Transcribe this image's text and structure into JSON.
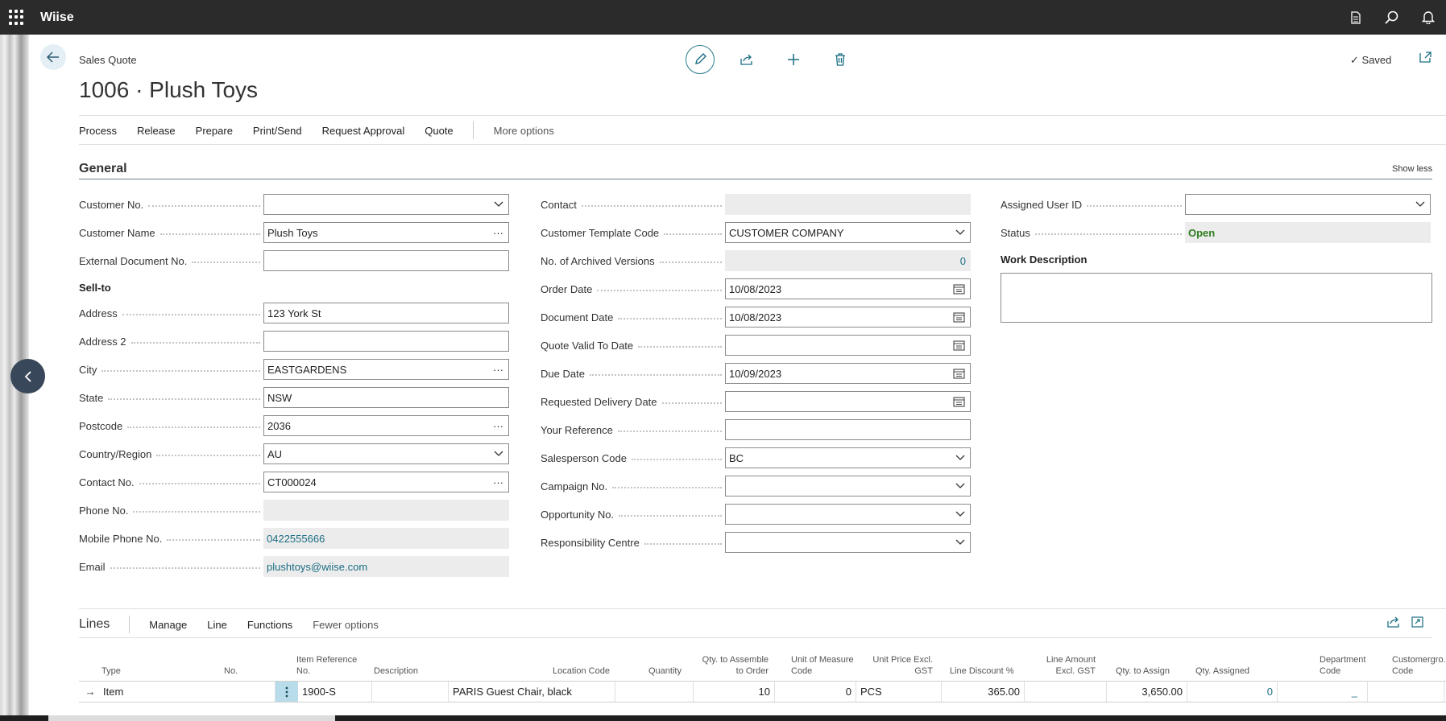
{
  "app": {
    "name": "Wiise"
  },
  "page": {
    "caption": "Sales Quote",
    "title": "1006 · Plush Toys",
    "saved_label": "Saved"
  },
  "menu": {
    "items": [
      "Process",
      "Release",
      "Prepare",
      "Print/Send",
      "Request Approval",
      "Quote"
    ],
    "more": "More options"
  },
  "general": {
    "title": "General",
    "show_less": "Show less",
    "sell_to_label": "Sell-to",
    "work_description_label": "Work Description",
    "col1": [
      {
        "label": "Customer No.",
        "value": ""
      },
      {
        "label": "Customer Name",
        "value": "Plush Toys"
      },
      {
        "label": "External Document No.",
        "value": ""
      },
      {
        "label": "Address",
        "value": "123 York St"
      },
      {
        "label": "Address 2",
        "value": ""
      },
      {
        "label": "City",
        "value": "EASTGARDENS"
      },
      {
        "label": "State",
        "value": "NSW"
      },
      {
        "label": "Postcode",
        "value": "2036"
      },
      {
        "label": "Country/Region",
        "value": "AU"
      },
      {
        "label": "Contact No.",
        "value": "CT000024"
      },
      {
        "label": "Phone No.",
        "value": ""
      },
      {
        "label": "Mobile Phone No.",
        "value": "0422555666"
      },
      {
        "label": "Email",
        "value": "plushtoys@wiise.com"
      }
    ],
    "col2": [
      {
        "label": "Contact",
        "value": ""
      },
      {
        "label": "Customer Template Code",
        "value": "CUSTOMER COMPANY"
      },
      {
        "label": "No. of Archived Versions",
        "value": "0"
      },
      {
        "label": "Order Date",
        "value": "10/08/2023"
      },
      {
        "label": "Document Date",
        "value": "10/08/2023"
      },
      {
        "label": "Quote Valid To Date",
        "value": ""
      },
      {
        "label": "Due Date",
        "value": "10/09/2023"
      },
      {
        "label": "Requested Delivery Date",
        "value": ""
      },
      {
        "label": "Your Reference",
        "value": ""
      },
      {
        "label": "Salesperson Code",
        "value": "BC"
      },
      {
        "label": "Campaign No.",
        "value": ""
      },
      {
        "label": "Opportunity No.",
        "value": ""
      },
      {
        "label": "Responsibility Centre",
        "value": ""
      }
    ],
    "col3": [
      {
        "label": "Assigned User ID",
        "value": ""
      },
      {
        "label": "Status",
        "value": "Open"
      }
    ]
  },
  "lines": {
    "title": "Lines",
    "menu": [
      "Manage",
      "Line",
      "Functions"
    ],
    "more": "Fewer options",
    "headers": {
      "type": "Type",
      "no": "No.",
      "item_ref": "Item Reference No.",
      "description": "Description",
      "location": "Location Code",
      "quantity": "Quantity",
      "qty_assemble": "Qty. to Assemble to Order",
      "uom": "Unit of Measure Code",
      "unit_price": "Unit Price Excl. GST",
      "line_discount": "Line Discount %",
      "line_amount": "Line Amount Excl. GST",
      "qty_assign": "Qty. to Assign",
      "qty_assigned": "Qty. Assigned",
      "department": "Department Code",
      "customergroup": "Customergro... Code"
    },
    "row": {
      "type": "Item",
      "no": "1900-S",
      "description": "PARIS Guest Chair, black",
      "quantity": "10",
      "qty_assemble": "0",
      "uom": "PCS",
      "unit_price": "365.00",
      "line_amount": "3,650.00",
      "qty_assign": "0",
      "qty_assigned": "_"
    }
  }
}
